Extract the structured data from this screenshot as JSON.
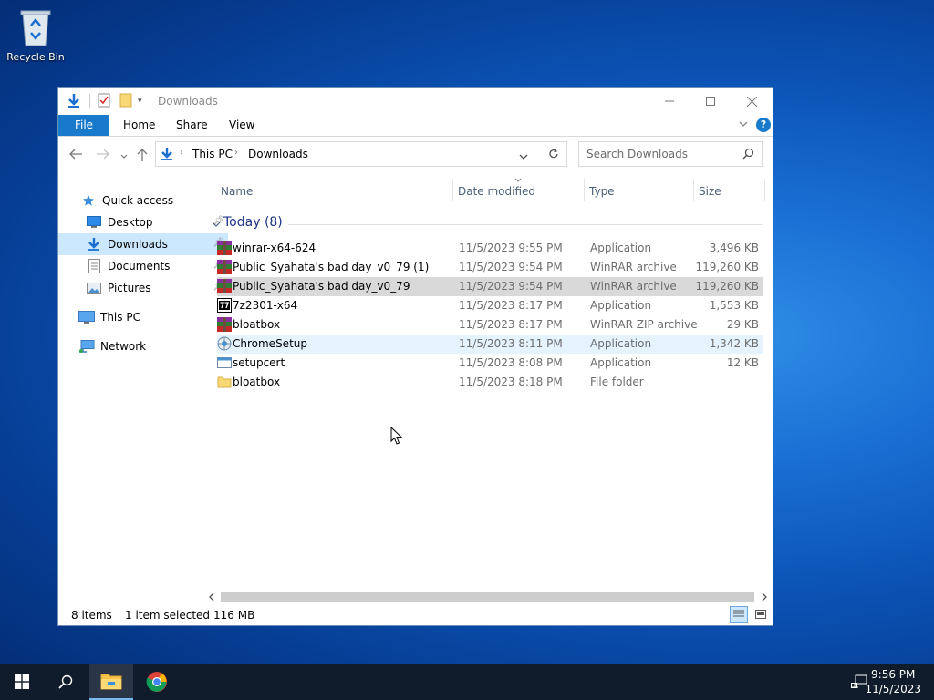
{
  "desktop": {
    "recycle_bin_label": "Recycle Bin"
  },
  "window": {
    "title": "Downloads",
    "ribbon_tabs": {
      "file": "File",
      "home": "Home",
      "share": "Share",
      "view": "View"
    },
    "breadcrumb": [
      "This PC",
      "Downloads"
    ],
    "search_placeholder": "Search Downloads",
    "nav": {
      "quick_access": "Quick access",
      "desktop": "Desktop",
      "downloads": "Downloads",
      "documents": "Documents",
      "pictures": "Pictures",
      "this_pc": "This PC",
      "network": "Network"
    },
    "columns": {
      "name": "Name",
      "date": "Date modified",
      "type": "Type",
      "size": "Size"
    },
    "group_label": "Today (8)",
    "files": [
      {
        "name": "winrar-x64-624",
        "date": "11/5/2023 9:55 PM",
        "type": "Application",
        "size": "3,496 KB",
        "icon": "winrar-icon"
      },
      {
        "name": "Public_Syahata's bad day_v0_79 (1)",
        "date": "11/5/2023 9:54 PM",
        "type": "WinRAR archive",
        "size": "119,260 KB",
        "icon": "winrar-icon"
      },
      {
        "name": "Public_Syahata's bad day_v0_79",
        "date": "11/5/2023 9:54 PM",
        "type": "WinRAR archive",
        "size": "119,260 KB",
        "icon": "winrar-icon"
      },
      {
        "name": "7z2301-x64",
        "date": "11/5/2023 8:17 PM",
        "type": "Application",
        "size": "1,553 KB",
        "icon": "7zip-icon"
      },
      {
        "name": "bloatbox",
        "date": "11/5/2023 8:17 PM",
        "type": "WinRAR ZIP archive",
        "size": "29 KB",
        "icon": "winrar-icon"
      },
      {
        "name": "ChromeSetup",
        "date": "11/5/2023 8:11 PM",
        "type": "Application",
        "size": "1,342 KB",
        "icon": "setup-icon"
      },
      {
        "name": "setupcert",
        "date": "11/5/2023 8:08 PM",
        "type": "Application",
        "size": "12 KB",
        "icon": "app-icon"
      },
      {
        "name": "bloatbox",
        "date": "11/5/2023 8:18 PM",
        "type": "File folder",
        "size": "",
        "icon": "folder-icon"
      }
    ],
    "status": {
      "items": "8 items",
      "selected": "1 item selected",
      "size": "116 MB"
    }
  },
  "taskbar": {
    "time": "9:56 PM",
    "date": "11/5/2023"
  },
  "colors": {
    "accent": "#1979ca",
    "selection": "#cce8ff",
    "selected_row": "#d9d9d9",
    "taskbar": "#101c2c"
  }
}
